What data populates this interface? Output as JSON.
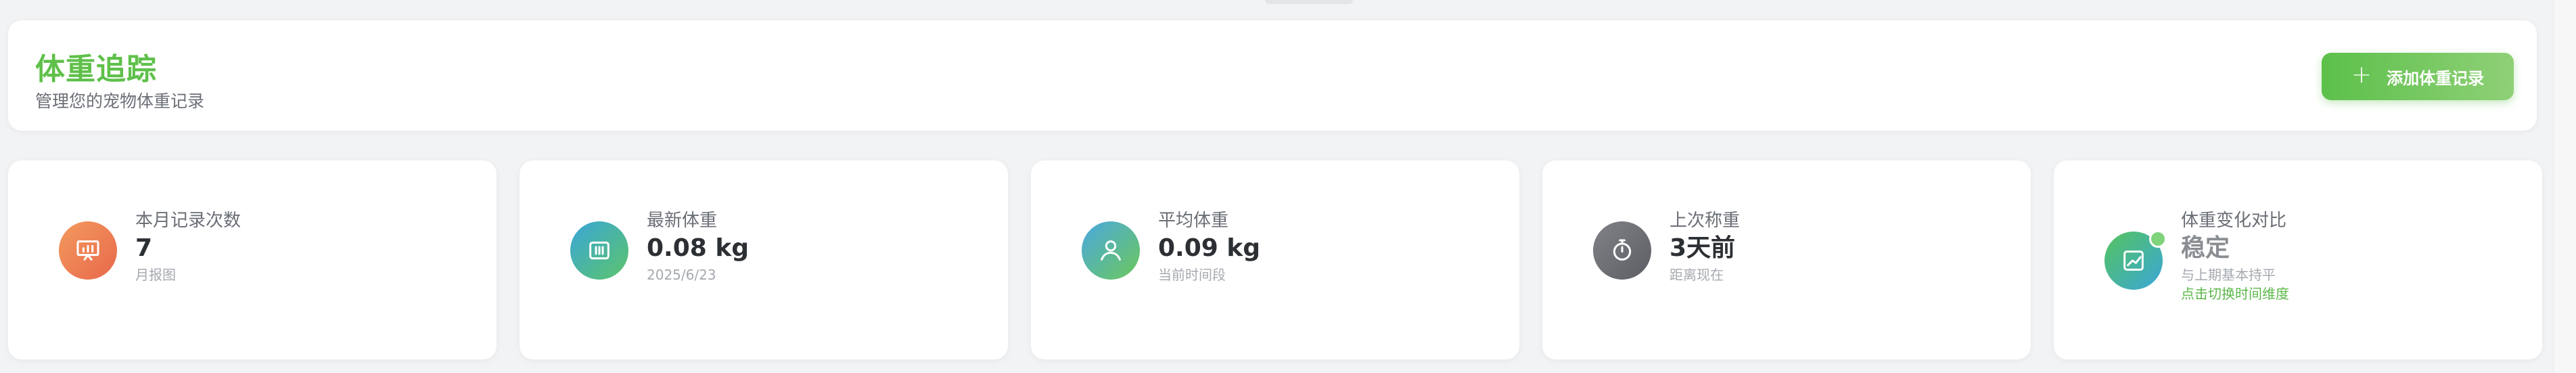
{
  "header": {
    "title": "体重追踪",
    "subtitle": "管理您的宠物体重记录",
    "add_button_label": "添加体重记录",
    "add_icon": "plus-icon"
  },
  "stats": [
    {
      "title": "本月记录次数",
      "value": "7",
      "desc": "月报图",
      "icon": "presentation-chart-icon",
      "gradient": [
        "#f08a5d",
        "#e86a4a"
      ]
    },
    {
      "title": "最新体重",
      "value": "0.08 kg",
      "desc": "2025/6/23",
      "icon": "bar-chart-icon",
      "gradient": [
        "#3aa6d8",
        "#5cc46a"
      ]
    },
    {
      "title": "平均体重",
      "value": "0.09 kg",
      "desc": "当前时间段",
      "icon": "user-icon",
      "gradient": [
        "#4aa8e0",
        "#6cc85a"
      ]
    },
    {
      "title": "上次称重",
      "value": "3天前",
      "desc": "距离现在",
      "icon": "stopwatch-icon",
      "gradient": [
        "#7d7f84",
        "#5c5e63"
      ]
    },
    {
      "title": "体重变化对比",
      "value": "稳定",
      "desc": "与上期基本持平",
      "link": "点击切换时间维度",
      "icon": "trend-chart-icon",
      "gradient": [
        "#55c45e",
        "#3aa6d8"
      ]
    }
  ]
}
